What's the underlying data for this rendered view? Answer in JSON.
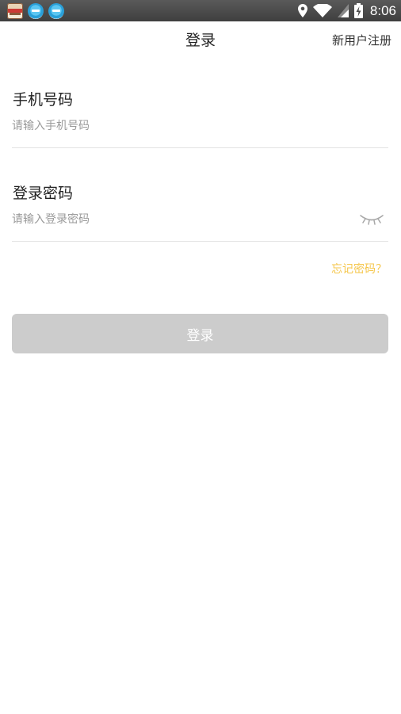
{
  "status_bar": {
    "time": "8:06",
    "icons": [
      "app-icon-album",
      "app-icon-fox-1",
      "app-icon-fox-2",
      "location-icon",
      "wifi-icon",
      "signal-icon",
      "battery-charging-icon"
    ]
  },
  "header": {
    "title": "登录",
    "register_label": "新用户注册"
  },
  "phone": {
    "label": "手机号码",
    "placeholder": "请输入手机号码",
    "value": ""
  },
  "password": {
    "label": "登录密码",
    "placeholder": "请输入登录密码",
    "value": "",
    "toggle_icon": "eye-closed-icon"
  },
  "forgot_label": "忘记密码？",
  "login_label": "登录",
  "colors": {
    "accent": "#f5c64a",
    "button_disabled": "#cccccc",
    "divider": "#e3e3e3",
    "placeholder": "#9a9a9a"
  }
}
